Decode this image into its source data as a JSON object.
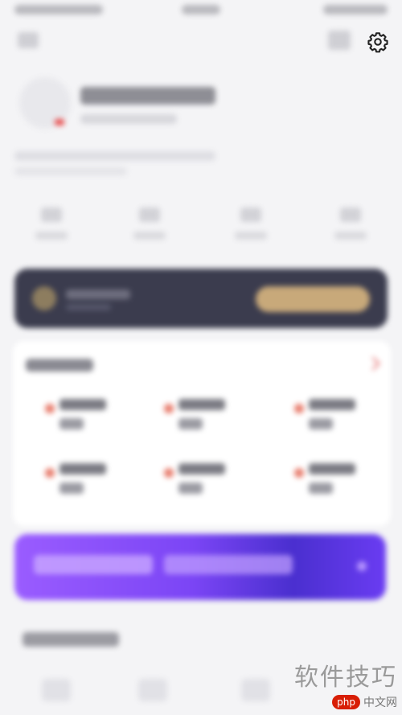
{
  "watermark": {
    "title": "软件技巧",
    "logo_text": "php",
    "site": "中文网"
  },
  "colors": {
    "background": "#f4f4f6",
    "vip_banner": "#3b3c4e",
    "vip_button": "#c8a97a",
    "promo_gradient": [
      "#9a5cff",
      "#7b45f5",
      "#4a2fcf",
      "#6a3cf2"
    ]
  },
  "icons": {
    "settings": "gear-icon"
  }
}
